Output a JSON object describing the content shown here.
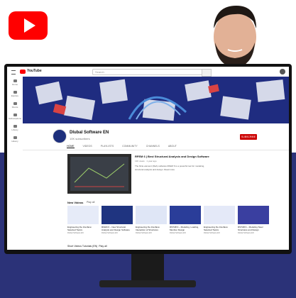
{
  "youtube": {
    "logo_name": "youtube-play-icon",
    "brand_color": "#ff0000"
  },
  "topbar": {
    "logo_text": "YouTube",
    "search_placeholder": "Search"
  },
  "sidebar": {
    "items": [
      {
        "label": "Home"
      },
      {
        "label": "Explore"
      },
      {
        "label": "Shorts"
      },
      {
        "label": "Subscriptions"
      },
      {
        "label": "Library"
      },
      {
        "label": "History"
      }
    ]
  },
  "channel": {
    "name": "Dlubal Software EN",
    "subscribers": "10K subscribers",
    "subscribe_label": "SUBSCRIBE"
  },
  "tabs": [
    "HOME",
    "VIDEOS",
    "PLAYLISTS",
    "COMMUNITY",
    "CHANNELS",
    "ABOUT"
  ],
  "featured": {
    "title": "RFEM 6 | Best Structural Analysis and Design Software",
    "meta": "13K views · 1 year ago",
    "description": "The finite element (FEA) software RFEM 6 is a powerful tool for modeling, structural analysis and design. Read more"
  },
  "section": {
    "title": "New Videos",
    "play_all": "Play all"
  },
  "videos": [
    {
      "title": "Engineering the Interface: Selected Topics",
      "meta": "Dlubal Software EN"
    },
    {
      "title": "RFEM 6 – New Structural Analysis and Design Software",
      "meta": "Dlubal Software EN"
    },
    {
      "title": "Engineering the Interface: Interaction of Structures",
      "meta": "Dlubal Software EN"
    },
    {
      "title": "RSTAB 9 – Modeling, Loading, Member Design",
      "meta": "Dlubal Software EN"
    },
    {
      "title": "Engineering the Interface: Selected Topics",
      "meta": "Dlubal Software EN"
    },
    {
      "title": "RSTAB 9 – Modeling Steel Structures and Design",
      "meta": "Dlubal Software EN"
    }
  ],
  "section2": {
    "title": "Short Videos Tutorials (EN)",
    "play_all": "Play all"
  }
}
